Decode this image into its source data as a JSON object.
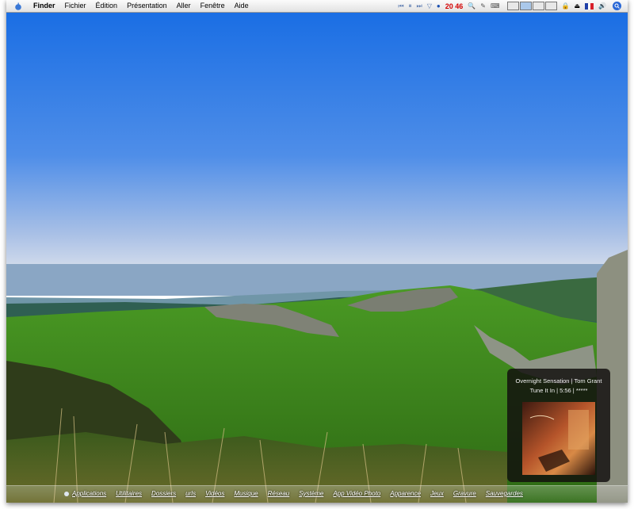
{
  "menubar": {
    "app_name": "Finder",
    "menus": [
      "Fichier",
      "Édition",
      "Présentation",
      "Aller",
      "Fenêtre",
      "Aide"
    ],
    "clock": "20 46",
    "icons": [
      "previous-track-icon",
      "pause-icon",
      "next-track-icon",
      "triangle-down-icon",
      "globe-icon",
      "magnifier-icon",
      "script-icon",
      "keyboard-icon",
      "lock-icon",
      "eject-icon",
      "french-flag-icon",
      "volume-icon",
      "spotlight-icon"
    ]
  },
  "now_playing": {
    "line1": "Overnight Sensation | Tom Grant",
    "line2": "Tune It In | 5:56 | *****"
  },
  "shelf": {
    "items": [
      "Applications",
      "Utilitaires",
      "Dossiers",
      "urls",
      "Vidéos",
      "Musique",
      "Réseau",
      "Système",
      "App Vidéo Photo",
      "Apparence",
      "Jeux",
      "Gravure",
      "Sauvegardes"
    ]
  },
  "colors": {
    "sky_top": "#1a6ee4",
    "sky_horizon": "#d9e0ec",
    "grass": "#3e8a1c",
    "clock": "#d40000"
  }
}
